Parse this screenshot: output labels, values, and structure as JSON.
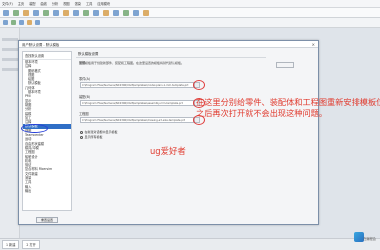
{
  "top_tabs": [
    "文件(F)",
    "主页",
    "装配",
    "曲线",
    "分析",
    "视图",
    "渲染",
    "工具",
    "应用模块"
  ],
  "dialog": {
    "title": "用户默认设置 - 默认模板",
    "close": "×",
    "tree_head": "查找默认设置",
    "tree": [
      {
        "label": "基本环境",
        "level": 0
      },
      {
        "label": "注释",
        "level": 0
      },
      {
        "label": "图纸格式",
        "level": 1
      },
      {
        "label": "视图",
        "level": 1
      },
      {
        "label": "绘图",
        "level": 1
      },
      {
        "label": "默认模板",
        "level": 1
      },
      {
        "label": "几何体",
        "level": 0
      },
      {
        "label": "基本环境",
        "level": 1
      },
      {
        "label": "PMI",
        "level": 0
      },
      {
        "label": "显示",
        "level": 0
      },
      {
        "label": "制图",
        "level": 0
      },
      {
        "label": "分析",
        "level": 0
      },
      {
        "label": "建模",
        "level": 0
      },
      {
        "label": "加工",
        "level": 0
      },
      {
        "label": "注释",
        "level": 0
      },
      {
        "label": "默认模板",
        "level": 0,
        "selected": true
      },
      {
        "label": "视图",
        "level": 0
      },
      {
        "label": "Teamcenter",
        "level": 0
      },
      {
        "label": "运动",
        "level": 0
      },
      {
        "label": "自由形状建模",
        "level": 0
      },
      {
        "label": "模具/冲模",
        "level": 0
      },
      {
        "label": "工程图",
        "level": 0
      },
      {
        "label": "船舶设计",
        "level": 0
      },
      {
        "label": "机电",
        "level": 0
      },
      {
        "label": "验证",
        "level": 0
      },
      {
        "label": "复合材料 Fibersim",
        "level": 0
      },
      {
        "label": "文件新建",
        "level": 0
      },
      {
        "label": "测量",
        "level": 0
      },
      {
        "label": "工具",
        "level": 0
      },
      {
        "label": "输入",
        "level": 0
      },
      {
        "label": "输出",
        "level": 0
      }
    ],
    "restore_button": "重置设置",
    "content_head": "默认模板设置",
    "section_title": "常规",
    "description": "这些模板用于创建新部件、装配和工程图。在这里设置的模板将替代默认模板。",
    "fields": [
      {
        "label": "零件(A)",
        "value": "C:\\Program Files\\Siemens\\NX2306\\UGII\\templates\\model-plain-1-mm-template.prt"
      },
      {
        "label": "装配(B)",
        "value": "C:\\Program Files\\Siemens\\NX2306\\UGII\\templates\\assembly-mm-template.prt"
      },
      {
        "label": "工程图",
        "value": "C:\\Program Files\\Siemens\\NX2306\\UGII\\templates\\drawing-a3-size-template.prt"
      }
    ],
    "radios": [
      {
        "label": "在新建对话框中显示模板",
        "on": true
      },
      {
        "label": "显示所有模板",
        "on": false
      }
    ]
  },
  "annotation": {
    "line1": "在这里分别给零件、装配体和工程图重新安排模板位",
    "line2": "之后再次打开就不会出现这种问题。",
    "author": "ug爱好者"
  },
  "status_bar": {
    "tabs": [
      "1 新建",
      "2 打开"
    ]
  },
  "watermark": "在编程会"
}
